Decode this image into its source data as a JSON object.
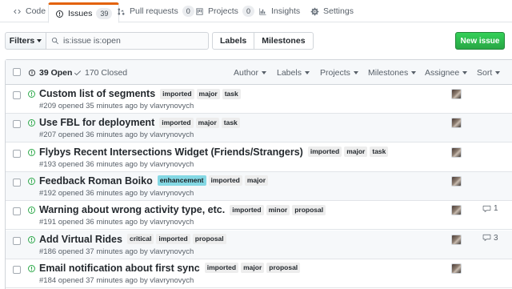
{
  "tabs": [
    {
      "label": "Code",
      "icon": "code-icon"
    },
    {
      "label": "Issues",
      "icon": "issue-opened-icon",
      "count": "39",
      "selected": true
    },
    {
      "label": "Pull requests",
      "icon": "git-pull-request-icon",
      "count": "0"
    },
    {
      "label": "Projects",
      "icon": "project-icon",
      "count": "0"
    },
    {
      "label": "Insights",
      "icon": "graph-icon"
    },
    {
      "label": "Settings",
      "icon": "gear-icon"
    }
  ],
  "filter_bar": {
    "filters_label": "Filters",
    "search_value": "is:issue is:open",
    "labels_label": "Labels",
    "milestones_label": "Milestones",
    "new_issue_label": "New issue"
  },
  "list_header": {
    "open_label": "39 Open",
    "closed_label": "170 Closed",
    "filters": [
      "Author",
      "Labels",
      "Projects",
      "Milestones",
      "Assignee",
      "Sort"
    ]
  },
  "colors": {
    "open_icon": "#28a745",
    "accent_tab": "#e36209",
    "new_issue_bg": "#28a745",
    "enhancement_label": "#84d8e4"
  },
  "issues": [
    {
      "title": "Custom list of segments",
      "labels": [
        "imported",
        "major",
        "task"
      ],
      "meta": "#209 opened 35 minutes ago by vlavrynovych",
      "comments": ""
    },
    {
      "title": "Use FBL for deployment",
      "labels": [
        "imported",
        "major",
        "task"
      ],
      "meta": "#207 opened 36 minutes ago by vlavrynovych",
      "comments": ""
    },
    {
      "title": "Flybys Recent Intersections Widget (Friends/Strangers)",
      "labels": [
        "imported",
        "major",
        "task"
      ],
      "meta": "#193 opened 36 minutes ago by vlavrynovych",
      "comments": ""
    },
    {
      "title": "Feedback Roman Boiko",
      "labels": [
        "enhancement",
        "imported",
        "major"
      ],
      "meta": "#192 opened 36 minutes ago by vlavrynovych",
      "comments": ""
    },
    {
      "title": "Warning about wrong activity type, etc.",
      "labels": [
        "imported",
        "minor",
        "proposal"
      ],
      "meta": "#191 opened 36 minutes ago by vlavrynovych",
      "comments": "1"
    },
    {
      "title": "Add Virtual Rides",
      "labels": [
        "critical",
        "imported",
        "proposal"
      ],
      "meta": "#186 opened 37 minutes ago by vlavrynovych",
      "comments": "3"
    },
    {
      "title": "Email notification about first sync",
      "labels": [
        "imported",
        "major",
        "proposal"
      ],
      "meta": "#184 opened 37 minutes ago by vlavrynovych",
      "comments": ""
    }
  ]
}
